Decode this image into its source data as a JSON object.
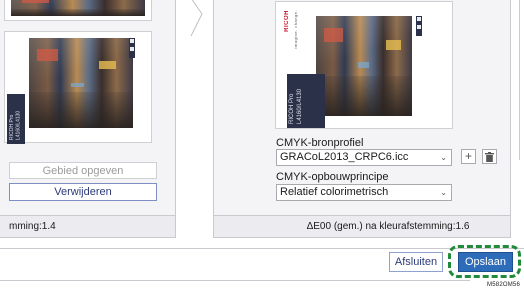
{
  "left_panel": {
    "preview_booklet_text": "RICOH Pro L4160/L4130",
    "area_button": "Gebied opgeven",
    "delete_button": "Verwijderen",
    "footer_text": "mming:1.4"
  },
  "right_panel": {
    "brand_text": "RICOH",
    "brand_subtext": "imagine. change.",
    "booklet_text": "RICOH Pro L4160/L4130",
    "source_profile": {
      "label": "CMYK-bronprofiel",
      "value": "GRACoL2013_CRPC6.icc",
      "add_icon": "plus-icon",
      "delete_icon": "trash-icon"
    },
    "build_principle": {
      "label": "CMYK-opbouwprincipe",
      "value": "Relatief colorimetrisch"
    },
    "footer_text": "ΔE00 (gem.) na kleurafstemming:1.6"
  },
  "actions": {
    "close_label": "Afsluiten",
    "save_label": "Opslaan",
    "highlight_color": "#1f8a3a",
    "save_color": "#2d6cb9"
  },
  "figure_id": "M582OM56"
}
